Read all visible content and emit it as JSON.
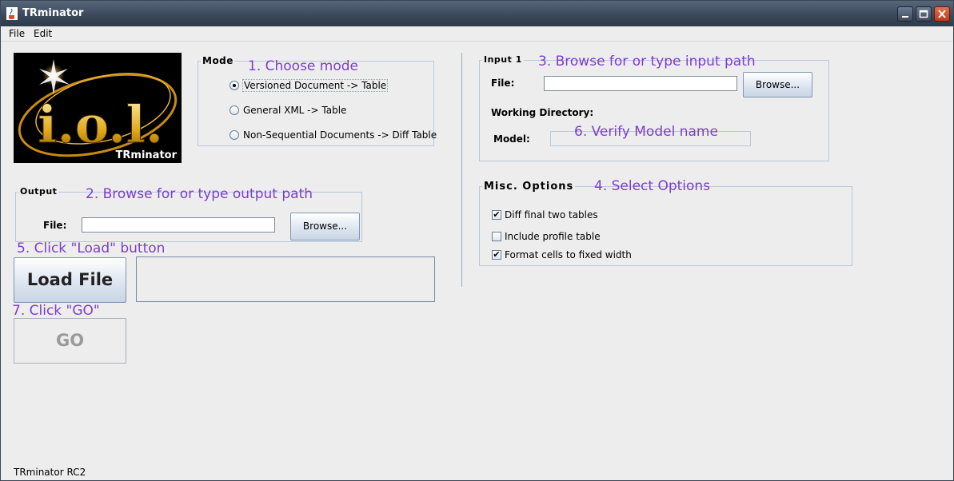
{
  "window": {
    "title": "TRminator"
  },
  "menubar": {
    "items": [
      "File",
      "Edit"
    ]
  },
  "logo": {
    "caption": "TRminator"
  },
  "mode": {
    "title": "Mode",
    "annotation": "1. Choose mode",
    "options": [
      {
        "label": "Versioned Document -> Table",
        "selected": true
      },
      {
        "label": "General XML -> Table",
        "selected": false
      },
      {
        "label": "Non-Sequential Documents -> Diff Table",
        "selected": false
      }
    ]
  },
  "output": {
    "title": "Output",
    "annotation": "2. Browse for or type output path",
    "file_label": "File:",
    "file_value": "",
    "browse_label": "Browse..."
  },
  "load": {
    "annotation": "5. Click \"Load\" button",
    "button_label": "Load File",
    "log_text": ""
  },
  "go": {
    "annotation": "7. Click \"GO\"",
    "button_label": "GO",
    "enabled": false
  },
  "input1": {
    "title": "Input 1",
    "annotation": "3. Browse for or type input path",
    "file_label": "File:",
    "file_value": "",
    "browse_label": "Browse...",
    "working_dir_label": "Working Directory:",
    "model_label": "Model:",
    "model_annotation": "6. Verify Model name",
    "model_value": ""
  },
  "misc": {
    "title": "Misc. Options",
    "annotation": "4. Select Options",
    "options": [
      {
        "label": "Diff final two tables",
        "checked": true
      },
      {
        "label": "Include profile table",
        "checked": false
      },
      {
        "label": "Format cells to fixed width",
        "checked": true
      }
    ]
  },
  "status": {
    "text": "TRminator RC2"
  },
  "colors": {
    "annotation": "#7c3fc9",
    "titlebar": "#3a475a",
    "groupbox_border": "#b9c8da"
  }
}
